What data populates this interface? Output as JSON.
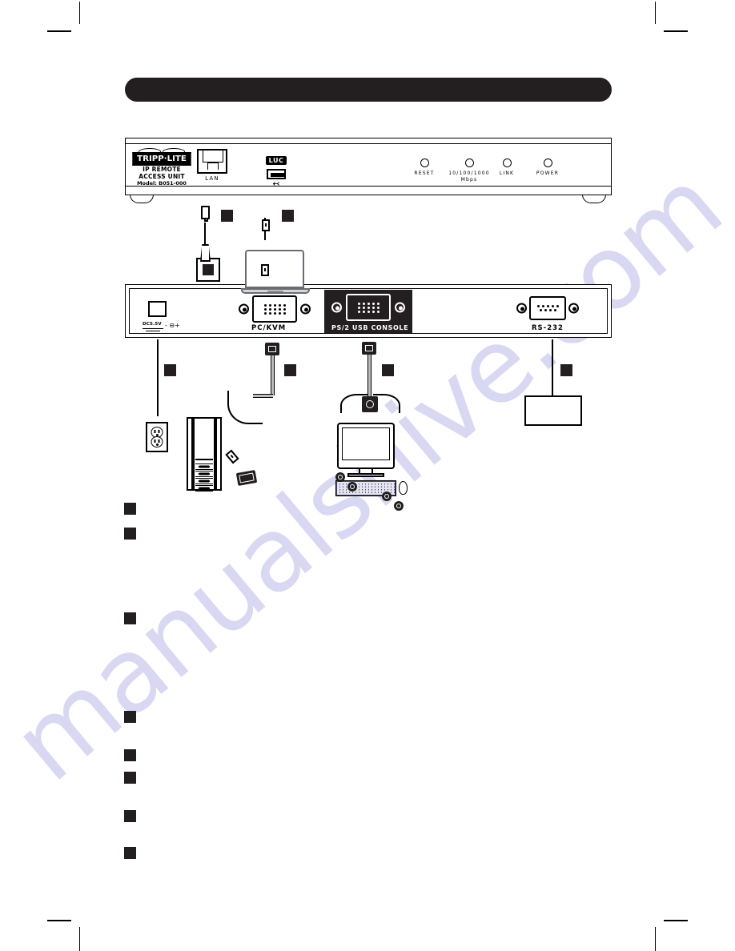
{
  "document": {
    "watermark": "manualshive.com"
  },
  "banner": {
    "title": ""
  },
  "front_panel": {
    "brand": "TRIPP·LITE",
    "product_line1": "IP REMOTE",
    "product_line2": "ACCESS UNIT",
    "model": "Model: B051-000",
    "lan_label": "LAN",
    "luc_badge": "LUC",
    "usb_symbol": "⎌",
    "leds": [
      {
        "name": "reset-led",
        "label": "RESET",
        "sublabel": ""
      },
      {
        "name": "speed-led",
        "label": "10/100/1000",
        "sublabel": "Mbps"
      },
      {
        "name": "link-led",
        "label": "LINK",
        "sublabel": ""
      },
      {
        "name": "power-led",
        "label": "POWER",
        "sublabel": ""
      }
    ]
  },
  "rear_panel": {
    "dc_label": "DC5.5V",
    "dc_polarity": "- ⊖+",
    "ports": [
      {
        "name": "pc-kvm-port",
        "label": "PC/KVM"
      },
      {
        "name": "console-port",
        "label": "PS/2  USB  CONSOLE"
      },
      {
        "name": "rs232-port",
        "label": "RS-232"
      }
    ]
  },
  "steps": [
    {
      "name": "step-marker-1",
      "label": ""
    },
    {
      "name": "step-marker-2",
      "label": ""
    },
    {
      "name": "step-marker-3",
      "label": ""
    },
    {
      "name": "step-marker-4",
      "label": ""
    },
    {
      "name": "step-marker-5",
      "label": ""
    },
    {
      "name": "step-marker-6",
      "label": ""
    },
    {
      "name": "step-marker-7",
      "label": ""
    },
    {
      "name": "step-marker-8",
      "label": ""
    }
  ],
  "callouts": [
    {
      "name": "callout-lan",
      "label": ""
    },
    {
      "name": "callout-usb-laptop",
      "label": ""
    },
    {
      "name": "callout-power",
      "label": ""
    },
    {
      "name": "callout-pc-kvm",
      "label": ""
    },
    {
      "name": "callout-console",
      "label": ""
    },
    {
      "name": "callout-rs232",
      "label": ""
    }
  ],
  "diagram": {
    "laptop": {
      "name": "laptop-device",
      "label": ""
    },
    "network": {
      "name": "network-device",
      "label": ""
    },
    "outlet": {
      "name": "wall-outlet",
      "label": ""
    },
    "tower": {
      "name": "computer-tower",
      "label": ""
    },
    "monitor": {
      "name": "monitor-device",
      "label": ""
    },
    "keyboard": {
      "name": "keyboard-device",
      "label": ""
    },
    "mouse": {
      "name": "mouse-device",
      "label": ""
    },
    "serial": {
      "name": "serial-device",
      "label": ""
    }
  }
}
